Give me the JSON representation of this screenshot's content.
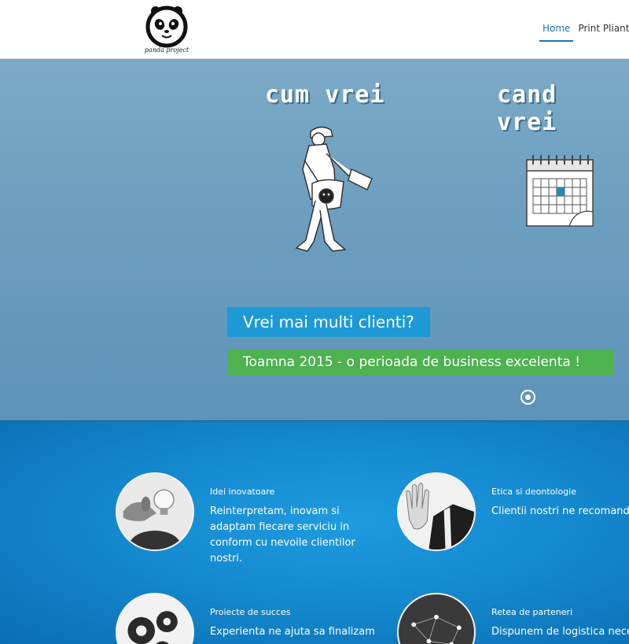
{
  "header": {
    "logo_caption": "panda project",
    "nav": [
      {
        "label": "Home",
        "active": true
      },
      {
        "label": "Print Pliante",
        "active": false
      }
    ]
  },
  "hero": {
    "title_left": "cum vrei",
    "title_right": "cand vrei",
    "caption_primary": "Vrei mai multi clienti?",
    "caption_secondary": "Toamna 2015 - o perioada de business excelenta !",
    "slide_count": 1,
    "active_slide": 1
  },
  "features": [
    {
      "title": "Idei inovatoare",
      "text": "Reinterpretam, inovam si adaptam fiecare serviciu in conform cu nevoile clientilor nostri.",
      "image": "lightbulb-hand-photo"
    },
    {
      "title": "Etica si deontologie",
      "text": "Clientii nostri ne recomanda pentru profesionalismul si corectitudinea de care am dovada in toate proiectele.",
      "image": "raised-hand-suit-photo"
    },
    {
      "title": "Proiecte de succes",
      "text": "Experienta ne ajuta sa finalizam",
      "image": "gears-photo"
    },
    {
      "title": "Retea de parteneri",
      "text": "Dispunem de logistica nece",
      "image": "network-globe-photo"
    }
  ],
  "colors": {
    "accent": "#1e73be",
    "caption_blue": "#1d9ad6",
    "caption_green": "#4db24f",
    "features_bg": "#1589cf"
  }
}
